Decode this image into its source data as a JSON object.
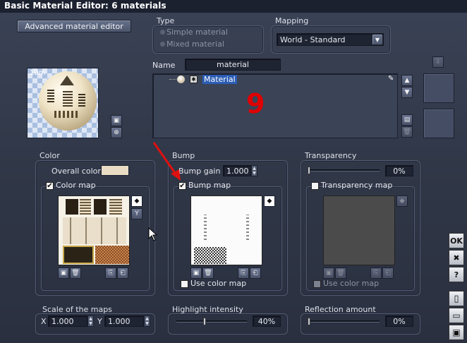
{
  "window": {
    "title": "Basic Material Editor: 6 materials"
  },
  "toolbar": {
    "advanced_label": "Advanced material editor"
  },
  "preview": {
    "label": "10m"
  },
  "type": {
    "title": "Type",
    "options": [
      "Simple material",
      "Mixed material"
    ]
  },
  "mapping": {
    "title": "Mapping",
    "value": "World - Standard"
  },
  "name": {
    "label": "Name",
    "value": "material"
  },
  "material_list": {
    "items": [
      {
        "label": "Material"
      }
    ],
    "overlay_number": "9"
  },
  "color": {
    "title": "Color",
    "overall_label": "Overall color:",
    "overall_color": "#e9dcc4",
    "map_label": "Color map",
    "map_checked": "✔"
  },
  "bump": {
    "title": "Bump",
    "gain_label": "Bump gain",
    "gain_value": "1.000",
    "map_label": "Bump map",
    "map_checked": "✔",
    "use_color_label": "Use color map"
  },
  "transparency": {
    "title": "Transparency",
    "value": "0%",
    "value_fraction": 0,
    "map_label": "Transparency map",
    "use_color_label": "Use color map"
  },
  "scale": {
    "title": "Scale of the maps",
    "x_label": "X",
    "x_value": "1.000",
    "y_label": "Y",
    "y_value": "1.000"
  },
  "highlight": {
    "title": "Highlight intensity",
    "value": "40%",
    "value_fraction": 0.4
  },
  "reflection": {
    "title": "Reflection amount",
    "value": "0%",
    "value_fraction": 0
  },
  "right_buttons": {
    "ok": "OK",
    "cancel": "✖",
    "help": "?"
  },
  "colors": {
    "annotation_red": "#e00000",
    "arrow_red": "#e01010"
  }
}
